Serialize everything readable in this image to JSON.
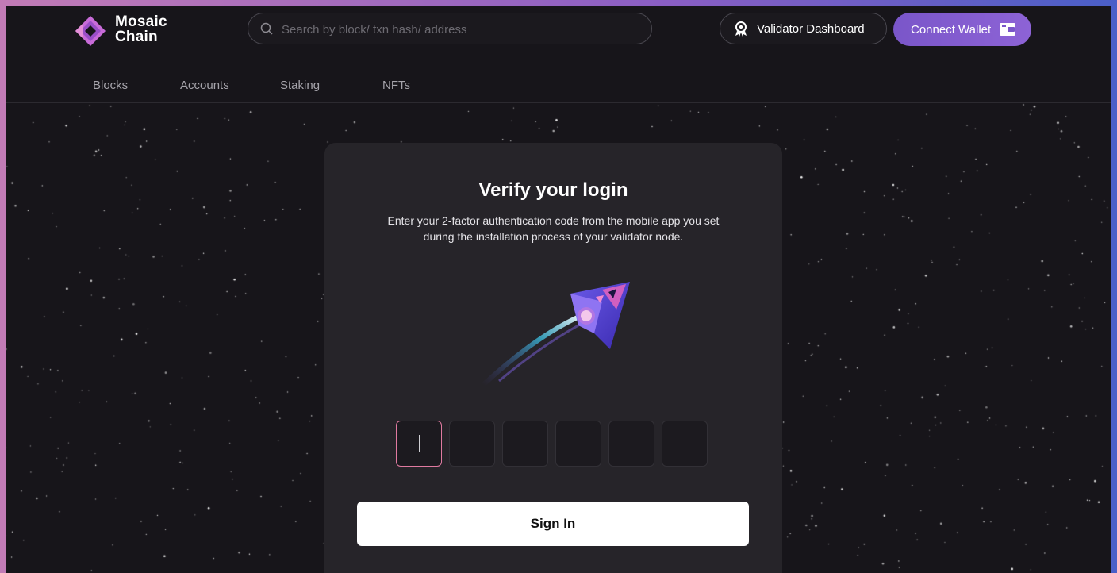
{
  "brand": {
    "line1": "Mosaic",
    "line2": "Chain",
    "accent": "#c86bd8"
  },
  "search": {
    "placeholder": "Search by block/ txn hash/ address",
    "icon": "search-icon"
  },
  "header_buttons": {
    "validator_label": "Validator Dashboard",
    "validator_icon": "user-badge-icon",
    "connect_label": "Connect Wallet",
    "connect_icon": "wallet-icon",
    "connect_color": "#7a56c9"
  },
  "nav": {
    "items": [
      {
        "label": "Blocks"
      },
      {
        "label": "Accounts"
      },
      {
        "label": "Staking"
      },
      {
        "label": "NFTs"
      }
    ]
  },
  "verify": {
    "title": "Verify your login",
    "description_line1": "Enter your 2-factor authentication code from the mobile app you set",
    "description_line2": "during the installation process of your validator node.",
    "illustration": "rocket-ship-illustration",
    "code_length": 6,
    "code_values": [
      "",
      "",
      "",
      "",
      "",
      ""
    ],
    "sign_in_label": "Sign In"
  },
  "colors": {
    "background": "#17151a",
    "card": "#262429",
    "active_box_border": "#e07aa0"
  }
}
